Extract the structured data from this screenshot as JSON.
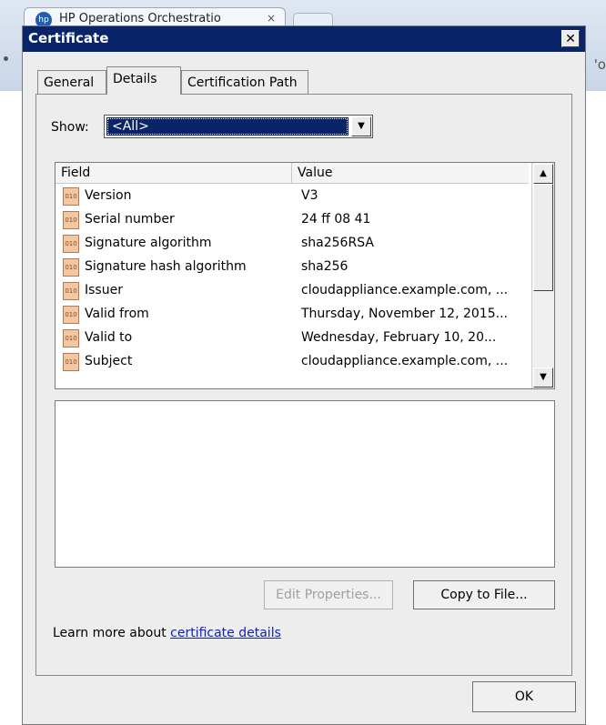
{
  "browser": {
    "tab_title": "HP Operations Orchestratio",
    "tab_icon": "hp",
    "tab_close": "×",
    "address_partial": "'o"
  },
  "dialog": {
    "title": "Certificate",
    "close_glyph": "✕"
  },
  "tabs": [
    {
      "label": "General"
    },
    {
      "label": "Details"
    },
    {
      "label": "Certification Path"
    }
  ],
  "show": {
    "label": "Show:",
    "selected": "<All>"
  },
  "list": {
    "columns": {
      "field": "Field",
      "value": "Value"
    },
    "rows": [
      {
        "field": "Version",
        "value": "V3"
      },
      {
        "field": "Serial number",
        "value": "24 ff 08 41"
      },
      {
        "field": "Signature algorithm",
        "value": "sha256RSA"
      },
      {
        "field": "Signature hash algorithm",
        "value": "sha256"
      },
      {
        "field": "Issuer",
        "value": "cloudappliance.example.com, ..."
      },
      {
        "field": "Valid from",
        "value": "Thursday, November 12, 2015..."
      },
      {
        "field": "Valid to",
        "value": "Wednesday, February 10, 20..."
      },
      {
        "field": "Subject",
        "value": "cloudappliance.example.com, ..."
      }
    ]
  },
  "buttons": {
    "edit_properties": "Edit Properties...",
    "copy_to_file": "Copy to File...",
    "ok": "OK"
  },
  "learn_more": {
    "prefix": "Learn more about ",
    "link": "certificate details"
  }
}
